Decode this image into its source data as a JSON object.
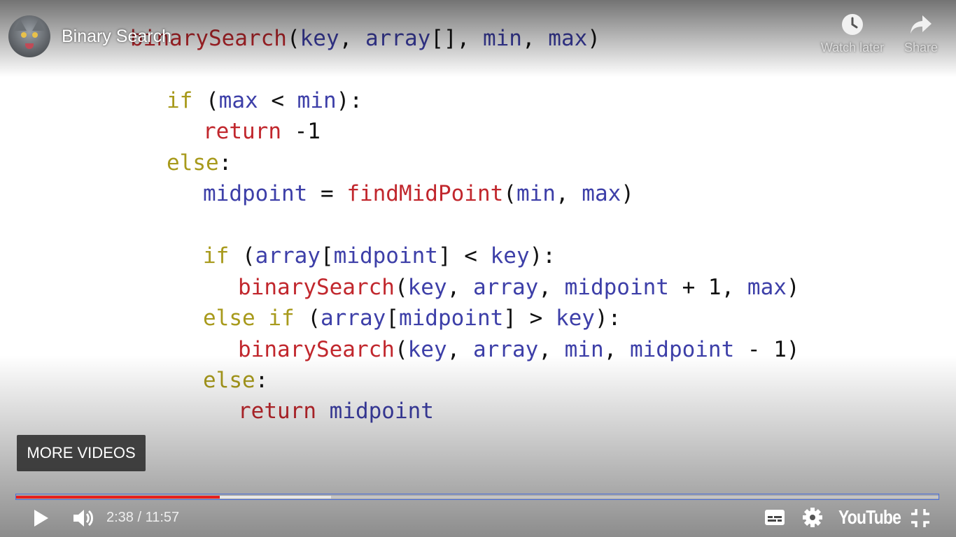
{
  "video": {
    "title": "Binary Search",
    "channel_avatar_icon": "cat-avatar-icon",
    "code_lines": [
      {
        "tokens": [
          {
            "t": "binarySearch",
            "c": "fn"
          },
          {
            "t": "(",
            "c": "op"
          },
          {
            "t": "key",
            "c": "var"
          },
          {
            "t": ", ",
            "c": "op"
          },
          {
            "t": "array",
            "c": "var"
          },
          {
            "t": "[], ",
            "c": "op"
          },
          {
            "t": "min",
            "c": "var"
          },
          {
            "t": ", ",
            "c": "op"
          },
          {
            "t": "max",
            "c": "var"
          },
          {
            "t": ")",
            "c": "op"
          }
        ]
      },
      {
        "tokens": [
          {
            "t": "if",
            "c": "kw"
          },
          {
            "t": " (",
            "c": "op"
          },
          {
            "t": "max",
            "c": "var"
          },
          {
            "t": " < ",
            "c": "op"
          },
          {
            "t": "min",
            "c": "var"
          },
          {
            "t": "):",
            "c": "op"
          }
        ]
      },
      {
        "tokens": [
          {
            "t": "return",
            "c": "fn"
          },
          {
            "t": " -1",
            "c": "num"
          }
        ]
      },
      {
        "tokens": [
          {
            "t": "else",
            "c": "kw"
          },
          {
            "t": ":",
            "c": "op"
          }
        ]
      },
      {
        "tokens": [
          {
            "t": "midpoint",
            "c": "var"
          },
          {
            "t": " = ",
            "c": "op"
          },
          {
            "t": "findMidPoint",
            "c": "fn"
          },
          {
            "t": "(",
            "c": "op"
          },
          {
            "t": "min",
            "c": "var"
          },
          {
            "t": ", ",
            "c": "op"
          },
          {
            "t": "max",
            "c": "var"
          },
          {
            "t": ")",
            "c": "op"
          }
        ]
      },
      {
        "tokens": [
          {
            "t": "if",
            "c": "kw"
          },
          {
            "t": " (",
            "c": "op"
          },
          {
            "t": "array",
            "c": "var"
          },
          {
            "t": "[",
            "c": "op"
          },
          {
            "t": "midpoint",
            "c": "var"
          },
          {
            "t": "] < ",
            "c": "op"
          },
          {
            "t": "key",
            "c": "var"
          },
          {
            "t": "):",
            "c": "op"
          }
        ]
      },
      {
        "tokens": [
          {
            "t": "binarySearch",
            "c": "fn"
          },
          {
            "t": "(",
            "c": "op"
          },
          {
            "t": "key",
            "c": "var"
          },
          {
            "t": ", ",
            "c": "op"
          },
          {
            "t": "array",
            "c": "var"
          },
          {
            "t": ", ",
            "c": "op"
          },
          {
            "t": "midpoint",
            "c": "var"
          },
          {
            "t": " + 1, ",
            "c": "op"
          },
          {
            "t": "max",
            "c": "var"
          },
          {
            "t": ")",
            "c": "op"
          }
        ]
      },
      {
        "tokens": [
          {
            "t": "else if",
            "c": "kw"
          },
          {
            "t": " (",
            "c": "op"
          },
          {
            "t": "array",
            "c": "var"
          },
          {
            "t": "[",
            "c": "op"
          },
          {
            "t": "midpoint",
            "c": "var"
          },
          {
            "t": "] > ",
            "c": "op"
          },
          {
            "t": "key",
            "c": "var"
          },
          {
            "t": "):",
            "c": "op"
          }
        ]
      },
      {
        "tokens": [
          {
            "t": "binarySearch",
            "c": "fn"
          },
          {
            "t": "(",
            "c": "op"
          },
          {
            "t": "key",
            "c": "var"
          },
          {
            "t": ", ",
            "c": "op"
          },
          {
            "t": "array",
            "c": "var"
          },
          {
            "t": ", ",
            "c": "op"
          },
          {
            "t": "min",
            "c": "var"
          },
          {
            "t": ", ",
            "c": "op"
          },
          {
            "t": "midpoint",
            "c": "var"
          },
          {
            "t": " - 1)",
            "c": "op"
          }
        ]
      },
      {
        "tokens": [
          {
            "t": "else",
            "c": "kw"
          },
          {
            "t": ":",
            "c": "op"
          }
        ]
      },
      {
        "tokens": [
          {
            "t": "return",
            "c": "fn"
          },
          {
            "t": " ",
            "c": "op"
          },
          {
            "t": "midpoint",
            "c": "var"
          }
        ]
      }
    ]
  },
  "top_actions": {
    "watch_later": {
      "label": "Watch later",
      "icon": "clock-icon"
    },
    "share": {
      "label": "Share",
      "icon": "share-arrow-icon"
    }
  },
  "more_videos_label": "MORE VIDEOS",
  "player": {
    "time_display": "2:38 / 11:57",
    "progress_played_fraction": 0.2207,
    "progress_buffered_fraction": 0.3417,
    "logo_text": "YouTube",
    "icons": {
      "play": "play-icon",
      "volume": "volume-icon",
      "subtitles": "subtitles-icon",
      "settings": "gear-icon",
      "exit_fullscreen": "exit-fullscreen-icon"
    }
  },
  "colors": {
    "keyword": "#a89a1c",
    "function": "#c1272d",
    "variable": "#3d3fa8",
    "progress_played": "#e5201f"
  }
}
